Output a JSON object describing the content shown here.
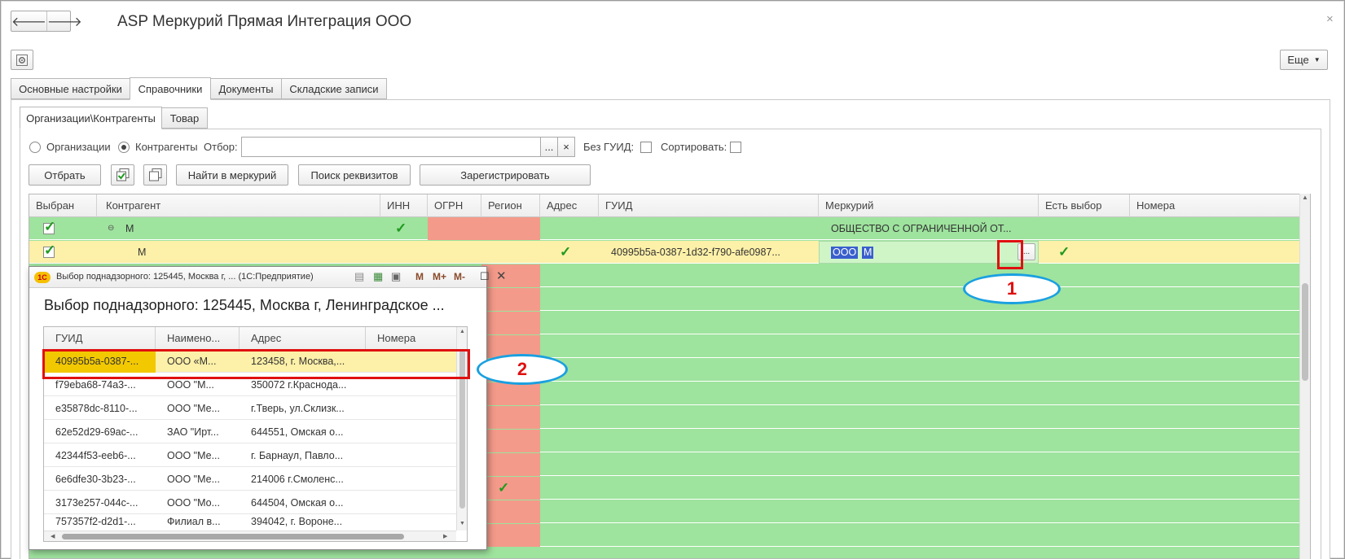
{
  "app": {
    "title": "ASP Меркурий Прямая Интеграция ООО",
    "more_label": "Еще",
    "close_glyph": "×",
    "back_glyph": "🡐",
    "forward_glyph": "🡒"
  },
  "main_tabs": [
    "Основные настройки",
    "Справочники",
    "Документы",
    "Складские записи"
  ],
  "sub_tabs": [
    "Организации\\Контрагенты",
    "Товар"
  ],
  "filter": {
    "radio_org": "Организации",
    "radio_contr": "Контрагенты",
    "otbor_label": "Отбор:",
    "otbor_value": "",
    "ellipsis": "...",
    "clear": "×",
    "no_guid_label": "Без ГУИД:",
    "sort_label": "Сортировать:"
  },
  "toolbar": {
    "select_label": "Отбрать",
    "find_label": "Найти в меркурий",
    "search_label": "Поиск реквизитов",
    "register_label": "Зарегистрировать"
  },
  "grid": {
    "columns": [
      "Выбран",
      "Контрагент",
      "ИНН",
      "ОГРН",
      "Регион",
      "Адрес",
      "ГУИД",
      "Меркурий",
      "Есть выбор",
      "Номера"
    ],
    "row1": {
      "contr": "М",
      "merc": "ОБЩЕСТВО С ОГРАНИЧЕННОЙ ОТ..."
    },
    "row2": {
      "contr": "М",
      "guid": "40995b5a-0387-1d32-f790-afe0987...",
      "merc_a": "ООО",
      "merc_b": "М",
      "btn": "..."
    }
  },
  "popup": {
    "window_title": "Выбор поднадзорного: 125445, Москва г, ... (1С:Предприятие)",
    "heading": "Выбор поднадзорного: 125445, Москва г, Ленинградское ...",
    "title_m": "M",
    "title_mplus": "M+",
    "title_mminus": "M-",
    "columns": [
      "ГУИД",
      "Наимено...",
      "Адрес",
      "Номера"
    ],
    "rows": [
      {
        "guid": "40995b5a-0387-...",
        "name": "ООО «М...",
        "addr": "123458, г. Москва,...",
        "num": ""
      },
      {
        "guid": "f79eba68-74a3-...",
        "name": "ООО \"М...",
        "addr": "350072 г.Краснода...",
        "num": ""
      },
      {
        "guid": "e35878dc-8110-...",
        "name": "ООО \"Ме...",
        "addr": "г.Тверь, ул.Склизк...",
        "num": ""
      },
      {
        "guid": "62e52d29-69ac-...",
        "name": "ЗАО \"Ирт...",
        "addr": "644551, Омская о...",
        "num": ""
      },
      {
        "guid": "42344f53-eeb6-...",
        "name": "ООО \"Ме...",
        "addr": "г. Барнаул, Павло...",
        "num": ""
      },
      {
        "guid": "6e6dfe30-3b23-...",
        "name": "ООО \"Ме...",
        "addr": "214006 г.Смоленс...",
        "num": ""
      },
      {
        "guid": "3173e257-044c-...",
        "name": "ООО \"Мо...",
        "addr": "644504, Омская о...",
        "num": ""
      },
      {
        "guid": "757357f2-d2d1-...",
        "name": "Филиал в...",
        "addr": "394042, г. Вороне...",
        "num": ""
      }
    ]
  },
  "annotations": {
    "one": "1",
    "two": "2"
  },
  "colors": {
    "green": "#9ee39e",
    "yellow": "#fdf0a8",
    "salmon": "#f49a8a",
    "red": "#e01010",
    "blue": "#1aa0e0"
  }
}
